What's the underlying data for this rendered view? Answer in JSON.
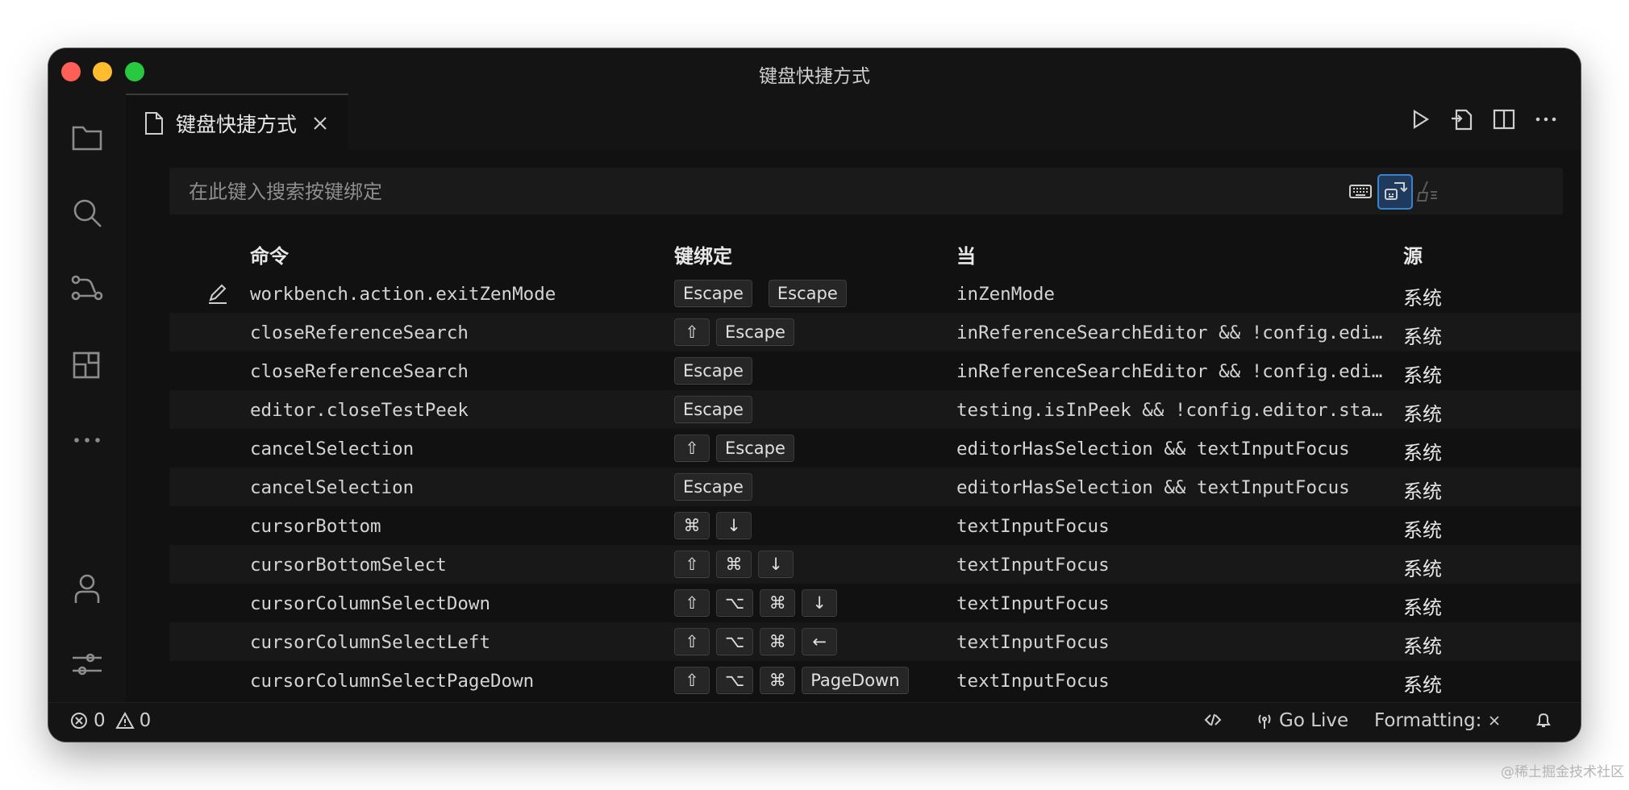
{
  "window": {
    "title": "键盘快捷方式"
  },
  "activity_bar": [
    {
      "icon": "explorer-icon"
    },
    {
      "icon": "search-icon"
    },
    {
      "icon": "source-control-icon"
    },
    {
      "icon": "extensions-icon"
    },
    {
      "icon": "more-icon"
    },
    {
      "icon": "accounts-icon"
    },
    {
      "icon": "manage-icon"
    }
  ],
  "tab": {
    "label": "键盘快捷方式",
    "icon": "file-icon"
  },
  "editor_actions": [
    "run-icon",
    "open-json-icon",
    "split-editor-icon",
    "more-actions-icon"
  ],
  "search": {
    "placeholder": "在此键入搜索按键绑定",
    "value": "",
    "actions": [
      "record-keys-icon",
      "sort-by-precedence-icon",
      "clear-input-icon"
    ]
  },
  "table": {
    "headers": {
      "command": "命令",
      "keybinding": "键绑定",
      "when": "当",
      "source": "源"
    },
    "rows": [
      {
        "command": "workbench.action.exitZenMode",
        "keys": [
          "Escape",
          "Escape"
        ],
        "chord": true,
        "when": "inZenMode",
        "source": "系统",
        "editing": true
      },
      {
        "command": "closeReferenceSearch",
        "keys": [
          "⇧",
          "Escape"
        ],
        "when": "inReferenceSearchEditor && !config.editor.stablePeek",
        "source": "系统"
      },
      {
        "command": "closeReferenceSearch",
        "keys": [
          "Escape"
        ],
        "when": "inReferenceSearchEditor && !config.editor.stablePeek",
        "source": "系统"
      },
      {
        "command": "editor.closeTestPeek",
        "keys": [
          "Escape"
        ],
        "when": "testing.isInPeek && !config.editor.stablePeek",
        "source": "系统"
      },
      {
        "command": "cancelSelection",
        "keys": [
          "⇧",
          "Escape"
        ],
        "when": "editorHasSelection && textInputFocus",
        "source": "系统"
      },
      {
        "command": "cancelSelection",
        "keys": [
          "Escape"
        ],
        "when": "editorHasSelection && textInputFocus",
        "source": "系统"
      },
      {
        "command": "cursorBottom",
        "keys": [
          "⌘",
          "↓"
        ],
        "when": "textInputFocus",
        "source": "系统"
      },
      {
        "command": "cursorBottomSelect",
        "keys": [
          "⇧",
          "⌘",
          "↓"
        ],
        "when": "textInputFocus",
        "source": "系统"
      },
      {
        "command": "cursorColumnSelectDown",
        "keys": [
          "⇧",
          "⌥",
          "⌘",
          "↓"
        ],
        "when": "textInputFocus",
        "source": "系统"
      },
      {
        "command": "cursorColumnSelectLeft",
        "keys": [
          "⇧",
          "⌥",
          "⌘",
          "←"
        ],
        "when": "textInputFocus",
        "source": "系统"
      },
      {
        "command": "cursorColumnSelectPageDown",
        "keys": [
          "⇧",
          "⌥",
          "⌘",
          "PageDown"
        ],
        "when": "textInputFocus",
        "source": "系统"
      }
    ]
  },
  "status_bar": {
    "errors": "0",
    "warnings": "0",
    "go_live": "Go Live",
    "formatting": "Formatting:"
  },
  "watermark": "@稀土掘金技术社区",
  "colors": {
    "background": "#111111",
    "accent": "#3a82d0",
    "traffic_close": "#fe5f57",
    "traffic_min": "#febc2e",
    "traffic_max": "#28c840"
  }
}
